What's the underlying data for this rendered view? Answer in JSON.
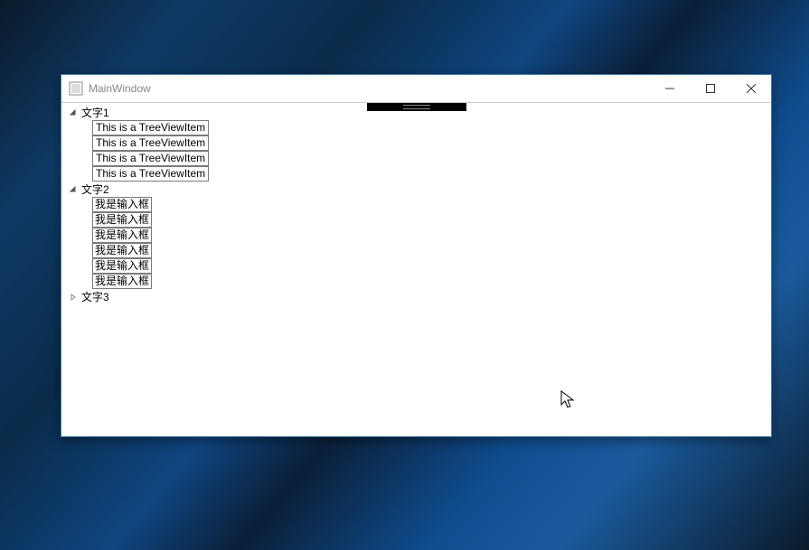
{
  "window": {
    "title": "MainWindow"
  },
  "tree": {
    "nodes": [
      {
        "label": "文字1",
        "expanded": true,
        "children_type": "textbox",
        "children": [
          "This is a TreeViewItem",
          "This is a TreeViewItem",
          "This is a TreeViewItem",
          "This is a TreeViewItem"
        ]
      },
      {
        "label": "文字2",
        "expanded": true,
        "children_type": "input",
        "children": [
          "我是输入框",
          "我是输入框",
          "我是输入框",
          "我是输入框",
          "我是输入框",
          "我是输入框"
        ]
      },
      {
        "label": "文字3",
        "expanded": false,
        "children_type": "none",
        "children": []
      }
    ]
  }
}
